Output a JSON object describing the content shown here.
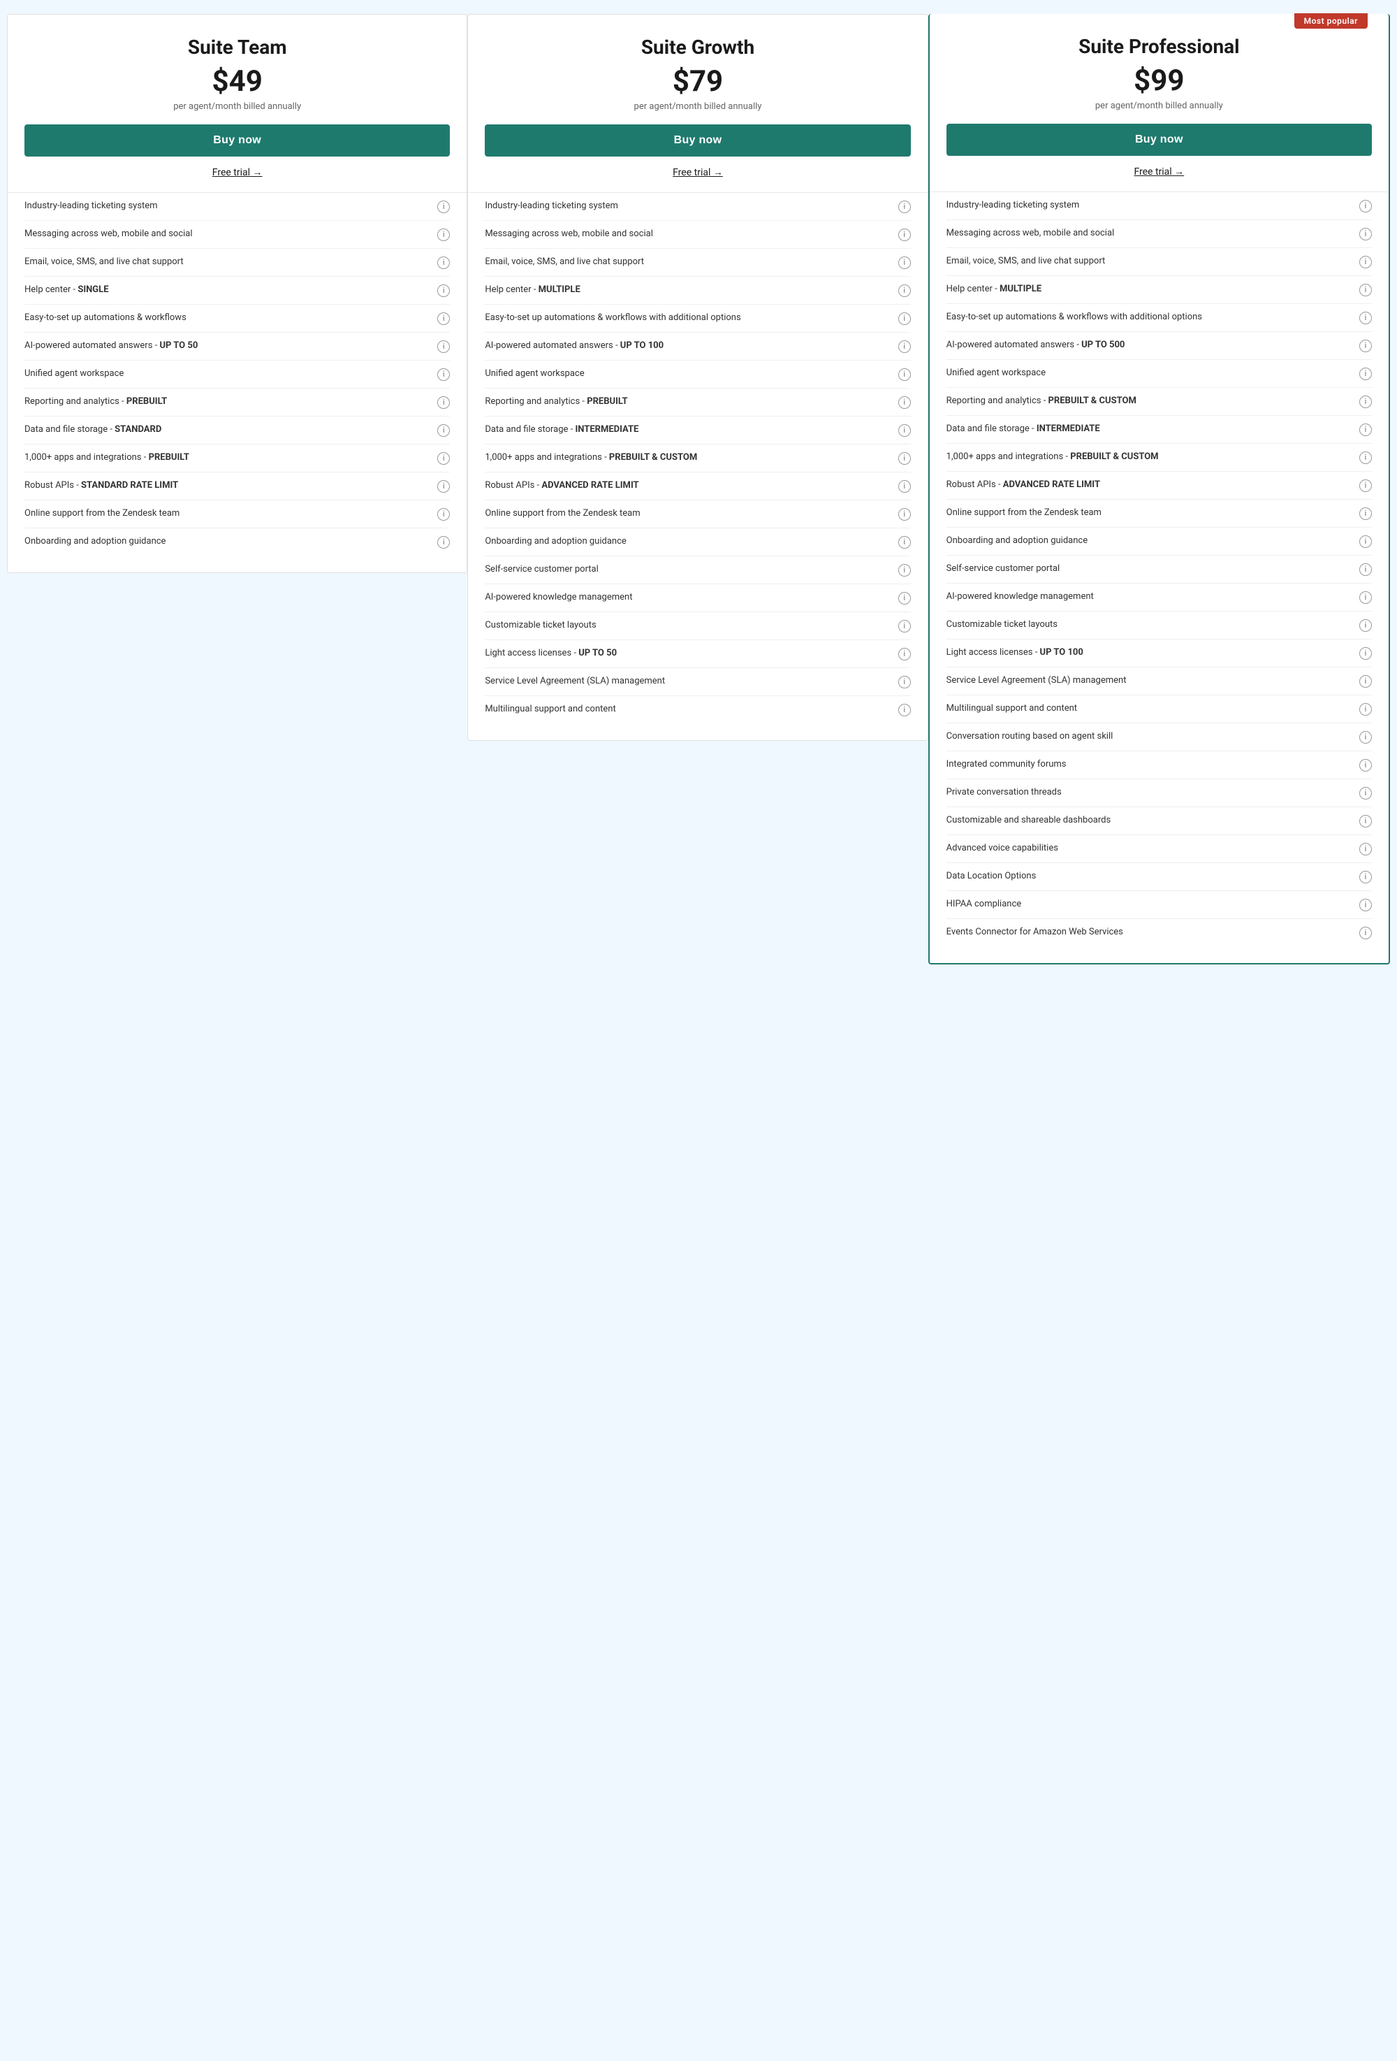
{
  "plans": [
    {
      "id": "suite-team",
      "name": "Suite Team",
      "price": "$49",
      "billing": "per agent/month billed annually",
      "buy_label": "Buy now",
      "free_trial_label": "Free trial →",
      "highlighted": false,
      "most_popular": false,
      "features": [
        {
          "text": "Industry-leading ticketing system"
        },
        {
          "text": "Messaging across web, mobile and social"
        },
        {
          "text": "Email, voice, SMS, and live chat support"
        },
        {
          "text": "Help center - ",
          "bold": "SINGLE"
        },
        {
          "text": "Easy-to-set up automations & workflows"
        },
        {
          "text": "AI-powered automated answers - ",
          "bold": "UP TO 50"
        },
        {
          "text": "Unified agent workspace"
        },
        {
          "text": "Reporting and analytics - ",
          "bold": "PREBUILT"
        },
        {
          "text": "Data and file storage - ",
          "bold": "STANDARD"
        },
        {
          "text": "1,000+ apps and integrations - ",
          "bold": "PREBUILT"
        },
        {
          "text": "Robust APIs - ",
          "bold": "STANDARD RATE LIMIT"
        },
        {
          "text": "Online support from the Zendesk team"
        },
        {
          "text": "Onboarding and adoption guidance"
        }
      ]
    },
    {
      "id": "suite-growth",
      "name": "Suite Growth",
      "price": "$79",
      "billing": "per agent/month billed annually",
      "buy_label": "Buy now",
      "free_trial_label": "Free trial →",
      "highlighted": false,
      "most_popular": false,
      "features": [
        {
          "text": "Industry-leading ticketing system"
        },
        {
          "text": "Messaging across web, mobile and social"
        },
        {
          "text": "Email, voice, SMS, and live chat support"
        },
        {
          "text": "Help center - ",
          "bold": "MULTIPLE"
        },
        {
          "text": "Easy-to-set up automations & workflows with additional options"
        },
        {
          "text": "AI-powered automated answers - ",
          "bold": "UP TO 100"
        },
        {
          "text": "Unified agent workspace"
        },
        {
          "text": "Reporting and analytics - ",
          "bold": "PREBUILT"
        },
        {
          "text": "Data and file storage - ",
          "bold": "INTERMEDIATE"
        },
        {
          "text": "1,000+ apps and integrations - ",
          "bold": "PREBUILT & CUSTOM"
        },
        {
          "text": "Robust APIs - ",
          "bold": "ADVANCED RATE LIMIT"
        },
        {
          "text": "Online support from the Zendesk team"
        },
        {
          "text": "Onboarding and adoption guidance"
        },
        {
          "text": "Self-service customer portal"
        },
        {
          "text": "AI-powered knowledge management"
        },
        {
          "text": "Customizable ticket layouts"
        },
        {
          "text": "Light access licenses - ",
          "bold": "UP TO 50"
        },
        {
          "text": "Service Level Agreement (SLA) management"
        },
        {
          "text": "Multilingual support and content"
        }
      ]
    },
    {
      "id": "suite-professional",
      "name": "Suite Professional",
      "price": "$99",
      "billing": "per agent/month billed annually",
      "buy_label": "Buy now",
      "free_trial_label": "Free trial →",
      "highlighted": true,
      "most_popular": true,
      "most_popular_label": "Most popular",
      "features": [
        {
          "text": "Industry-leading ticketing system"
        },
        {
          "text": "Messaging across web, mobile and social"
        },
        {
          "text": "Email, voice, SMS, and live chat support"
        },
        {
          "text": "Help center - ",
          "bold": "MULTIPLE"
        },
        {
          "text": "Easy-to-set up automations & workflows with additional options"
        },
        {
          "text": "AI-powered automated answers - ",
          "bold": "UP TO 500"
        },
        {
          "text": "Unified agent workspace"
        },
        {
          "text": "Reporting and analytics - ",
          "bold": "PREBUILT & CUSTOM"
        },
        {
          "text": "Data and file storage - ",
          "bold": "INTERMEDIATE"
        },
        {
          "text": "1,000+ apps and integrations - ",
          "bold": "PREBUILT & CUSTOM"
        },
        {
          "text": "Robust APIs - ",
          "bold": "ADVANCED RATE LIMIT"
        },
        {
          "text": "Online support from the Zendesk team"
        },
        {
          "text": "Onboarding and adoption guidance"
        },
        {
          "text": "Self-service customer portal"
        },
        {
          "text": "AI-powered knowledge management"
        },
        {
          "text": "Customizable ticket layouts"
        },
        {
          "text": "Light access licenses - ",
          "bold": "UP TO 100"
        },
        {
          "text": "Service Level Agreement (SLA) management"
        },
        {
          "text": "Multilingual support and content"
        },
        {
          "text": "Conversation routing based on agent skill"
        },
        {
          "text": "Integrated community forums"
        },
        {
          "text": "Private conversation threads"
        },
        {
          "text": "Customizable and shareable dashboards"
        },
        {
          "text": "Advanced voice capabilities"
        },
        {
          "text": "Data Location Options"
        },
        {
          "text": "HIPAA compliance"
        },
        {
          "text": "Events Connector for Amazon Web Services"
        }
      ]
    }
  ],
  "info_icon_label": "i"
}
